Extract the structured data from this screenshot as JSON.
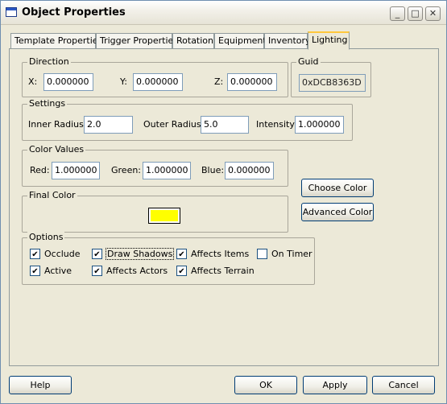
{
  "window": {
    "title": "Object Properties",
    "min": "_",
    "max": "□",
    "close": "✕"
  },
  "tabs": [
    "Template Properties",
    "Trigger Properties",
    "Rotation",
    "Equipment",
    "Inventory",
    "Lighting"
  ],
  "active_tab": "Lighting",
  "direction": {
    "legend": "Direction",
    "x_label": "X:",
    "x": "0.000000",
    "y_label": "Y:",
    "y": "0.000000",
    "z_label": "Z:",
    "z": "0.000000"
  },
  "guid": {
    "legend": "Guid",
    "value": "0xDCB8363D"
  },
  "settings": {
    "legend": "Settings",
    "inner_label": "Inner Radius:",
    "inner": "2.0",
    "outer_label": "Outer Radius:",
    "outer": "5.0",
    "intensity_label": "Intensity:",
    "intensity": "1.000000"
  },
  "color_values": {
    "legend": "Color Values",
    "red_label": "Red:",
    "red": "1.000000",
    "green_label": "Green:",
    "green": "1.000000",
    "blue_label": "Blue:",
    "blue": "0.000000"
  },
  "final_color": {
    "legend": "Final Color",
    "color": "#FFFF00"
  },
  "color_buttons": {
    "choose": "Choose Color",
    "advanced": "Advanced Color"
  },
  "options": {
    "legend": "Options",
    "items": [
      {
        "label": "Occlude",
        "checked": true
      },
      {
        "label": "Draw Shadows",
        "checked": true
      },
      {
        "label": "Affects Items",
        "checked": true
      },
      {
        "label": "On Timer",
        "checked": false
      },
      {
        "label": "Active",
        "checked": true
      },
      {
        "label": "Affects Actors",
        "checked": true
      },
      {
        "label": "Affects Terrain",
        "checked": true
      }
    ]
  },
  "footer": {
    "help": "Help",
    "ok": "OK",
    "apply": "Apply",
    "cancel": "Cancel"
  }
}
